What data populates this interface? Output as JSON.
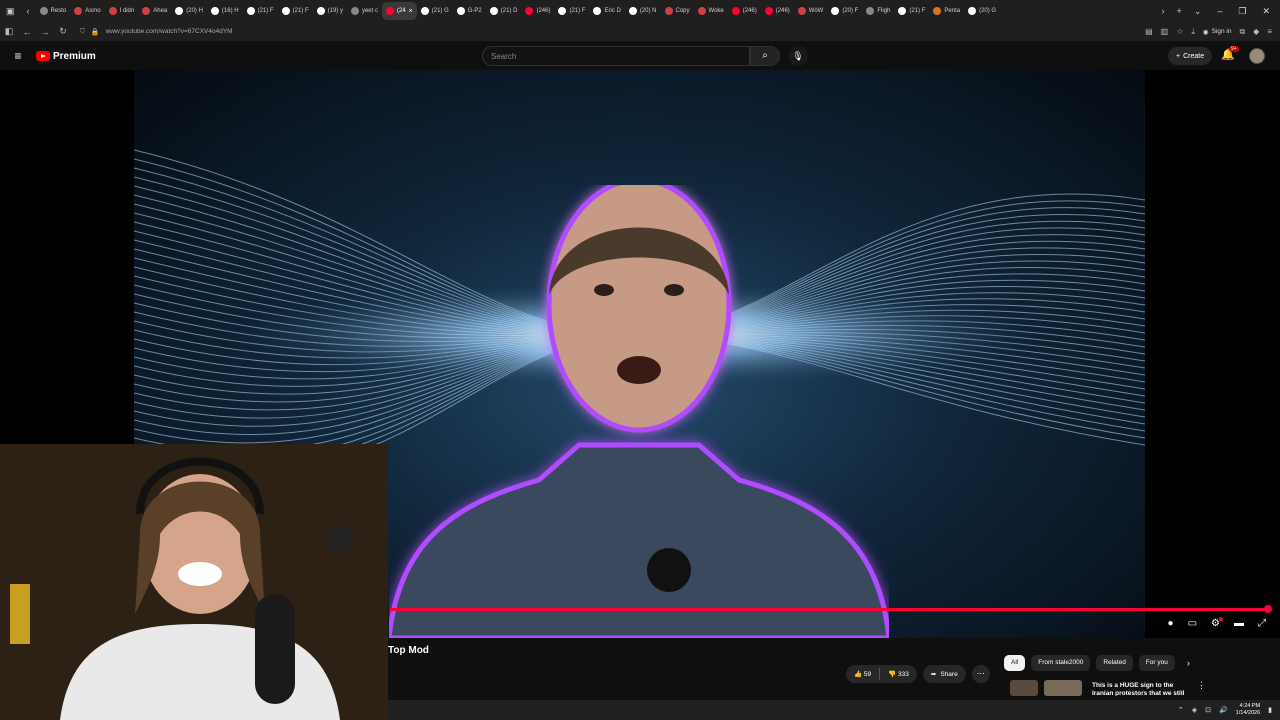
{
  "browser": {
    "tabs": [
      {
        "label": "Resto",
        "color": "#888888"
      },
      {
        "label": "Asmo",
        "color": "#d04040"
      },
      {
        "label": "I didn",
        "color": "#d04040"
      },
      {
        "label": "Ahea",
        "color": "#d04040"
      },
      {
        "label": "(20) H",
        "color": "#ffffff"
      },
      {
        "label": "(16) H",
        "color": "#ffffff"
      },
      {
        "label": "(21) F",
        "color": "#ffffff"
      },
      {
        "label": "(21) F",
        "color": "#ffffff"
      },
      {
        "label": "(19) y",
        "color": "#ffffff"
      },
      {
        "label": "yeet c",
        "color": "#888888"
      },
      {
        "label": "(24",
        "color": "#ff0033",
        "active": true
      },
      {
        "label": "(21) G",
        "color": "#ffffff"
      },
      {
        "label": "G-P2",
        "color": "#ffffff"
      },
      {
        "label": "(21) D",
        "color": "#ffffff"
      },
      {
        "label": "(246)",
        "color": "#ff0033"
      },
      {
        "label": "(21) F",
        "color": "#ffffff"
      },
      {
        "label": "Eric D",
        "color": "#ffffff"
      },
      {
        "label": "(20) N",
        "color": "#ffffff"
      },
      {
        "label": "Copy",
        "color": "#d04040"
      },
      {
        "label": "Woke",
        "color": "#d04040"
      },
      {
        "label": "(246)",
        "color": "#ff0033"
      },
      {
        "label": "(246)",
        "color": "#ff0033"
      },
      {
        "label": "WoW",
        "color": "#d04040"
      },
      {
        "label": "(20) F",
        "color": "#ffffff"
      },
      {
        "label": "Fligh",
        "color": "#888888"
      },
      {
        "label": "(21) F",
        "color": "#ffffff"
      },
      {
        "label": "Penta",
        "color": "#e07020"
      },
      {
        "label": "(20) G",
        "color": "#ffffff"
      }
    ],
    "new_tab": "+",
    "url": "www.youtube.com/watch?v=67CXV4o4dYM",
    "signin_label": "Sign in"
  },
  "youtube": {
    "brand": "Premium",
    "search_placeholder": "Search",
    "create_label": "Create",
    "notif_count": "9+",
    "video_title": "Top Mod",
    "likes": "59",
    "dislikes": "333",
    "share_label": "Share",
    "chips": [
      "All",
      "From stale2000",
      "Related",
      "For you"
    ],
    "rec_title": "This is a HUGE sign to the Iranian protestors that we still"
  },
  "taskbar": {
    "time": "4:24 PM",
    "date": "1/14/2026"
  },
  "colors": {
    "accent_red": "#ff0033",
    "bg": "#0f0f0f"
  }
}
